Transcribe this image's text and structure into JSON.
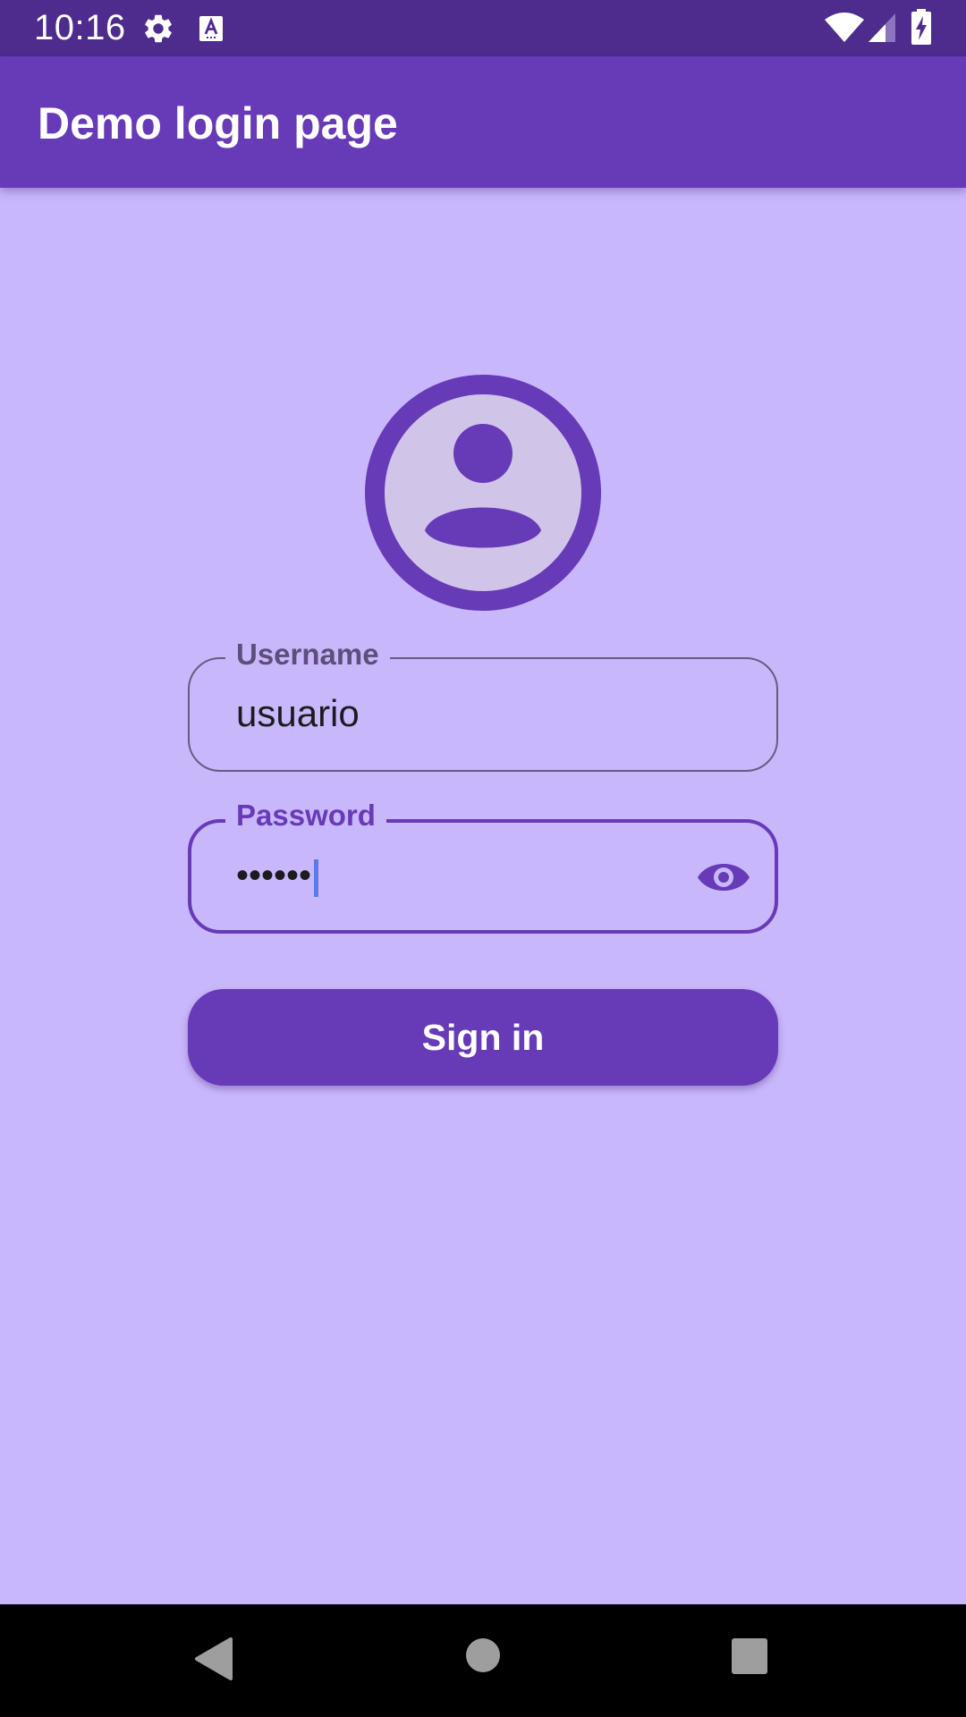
{
  "status_bar": {
    "time": "10:16",
    "icons": [
      "gear-icon",
      "a-notification-icon",
      "wifi-icon",
      "signal-icon",
      "battery-charging-icon"
    ]
  },
  "app_bar": {
    "title": "Demo login page"
  },
  "form": {
    "avatar_icon": "account-circle-icon",
    "username": {
      "label": "Username",
      "value": "usuario"
    },
    "password": {
      "label": "Password",
      "value": "••••••",
      "toggle_icon": "eye-icon"
    },
    "submit_label": "Sign in"
  },
  "nav_bar": {
    "icons": [
      "back-icon",
      "home-icon",
      "recents-icon"
    ]
  },
  "colors": {
    "status_bar": "#4d2c8d",
    "app_bar": "#673ab7",
    "background": "#c9b7fc",
    "primary": "#673ab7",
    "avatar_fill": "#d1c4e9"
  }
}
